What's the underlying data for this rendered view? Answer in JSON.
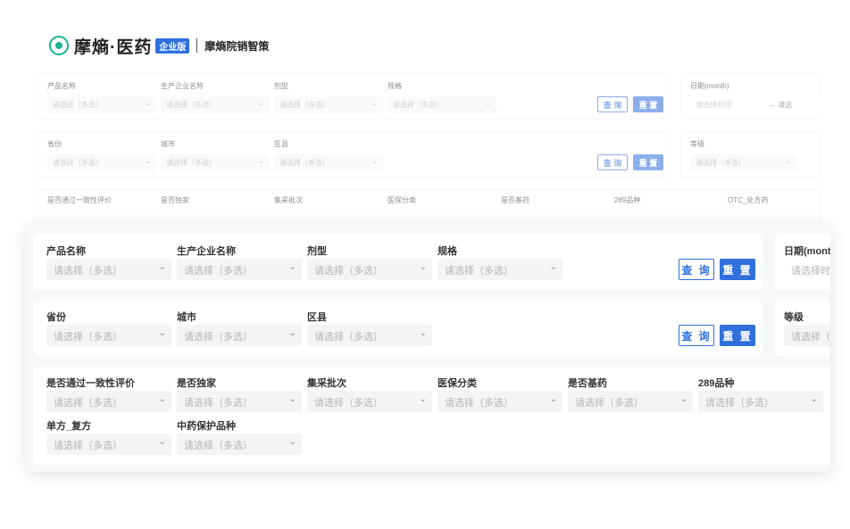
{
  "header": {
    "brand": "摩熵·医药",
    "edition": "企业版",
    "subtitle": "摩熵院销智策"
  },
  "placeholder": "请选择（多选）",
  "bg": {
    "row1_labels": [
      "产品名称",
      "生产企业名称",
      "剂型",
      "规格"
    ],
    "date_label": "日期(month)",
    "date_placeholder": "请选择时间",
    "date_arrow": "→ 请选",
    "row2_labels": [
      "省份",
      "城市",
      "区县"
    ],
    "grade_label": "等级",
    "row3_labels": [
      "是否通过一致性评价",
      "是否独家",
      "集采批次",
      "医保分类",
      "是否基药",
      "289品种",
      "OTC_处方药"
    ],
    "query": "查 询",
    "reset": "重 置"
  },
  "front": {
    "row1_labels": [
      "产品名称",
      "生产企业名称",
      "剂型",
      "规格"
    ],
    "date_label": "日期(month",
    "date_placeholder": "请选择时",
    "row2_labels": [
      "省份",
      "城市",
      "区县"
    ],
    "grade_label": "等级",
    "grade_placeholder": "请选择（",
    "row3_labels": [
      "是否通过一致性评价",
      "是否独家",
      "集采批次",
      "医保分类",
      "是否基药",
      "289品种"
    ],
    "row4_labels": [
      "单方_复方",
      "中药保护品种"
    ],
    "query": "查 询",
    "reset": "重 置"
  }
}
